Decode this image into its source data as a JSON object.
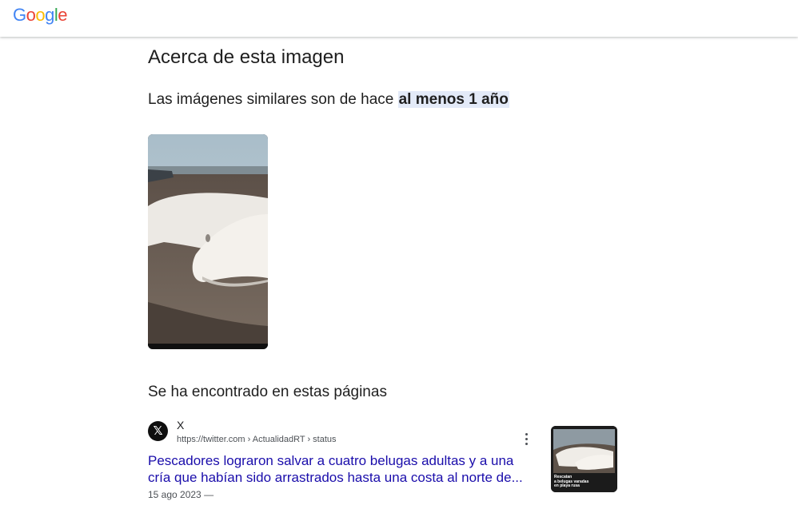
{
  "header": {
    "logo_letters": [
      "G",
      "o",
      "o",
      "g",
      "l",
      "e"
    ],
    "logo_colors": [
      "#4285F4",
      "#EA4335",
      "#FBBC05",
      "#4285F4",
      "#34A853",
      "#EA4335"
    ]
  },
  "about": {
    "heading": "Acerca de esta imagen",
    "age_prefix": "Las imágenes similares son de hace ",
    "age_highlight": "al menos 1 año"
  },
  "found": {
    "title": "Se ha encontrado en estas páginas",
    "results": [
      {
        "site_name": "X",
        "url": "https://twitter.com › ActualidadRT › status",
        "title_line1": "Pescadores lograron salvar a cuatro belugas adultas y a una",
        "title_line2": "cría que habían sido arrastrados hasta una costa al norte de...",
        "date": "15 ago 2023 —",
        "thumb_caption": "Rescatan\na belugas varadas\nen playa rusa"
      }
    ]
  },
  "colors": {
    "link": "#1a0dab",
    "highlight_bg": "#e3eaf8"
  }
}
